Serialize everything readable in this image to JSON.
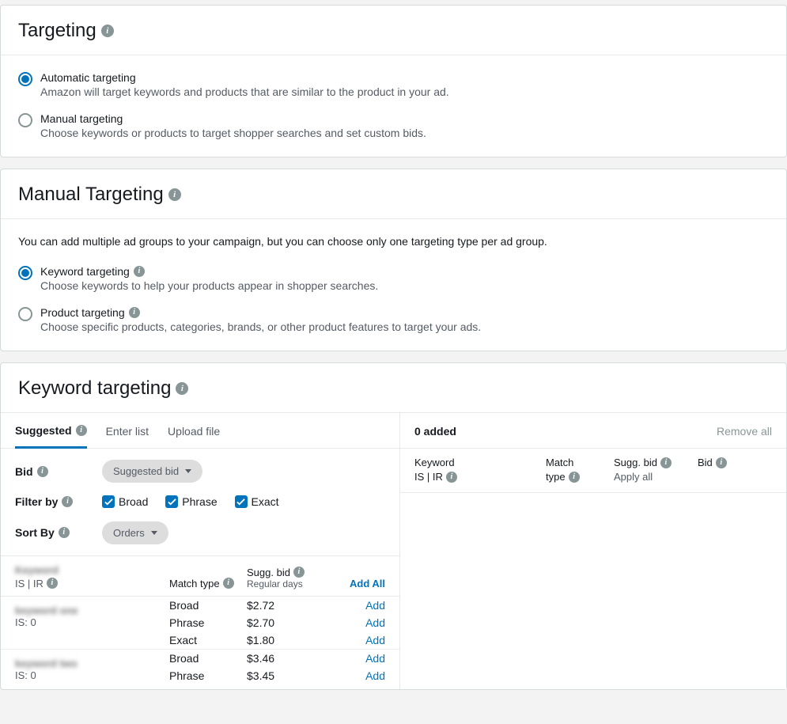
{
  "targeting": {
    "title": "Targeting",
    "options": [
      {
        "label": "Automatic targeting",
        "desc": "Amazon will target keywords and products that are similar to the product in your ad.",
        "selected": true
      },
      {
        "label": "Manual targeting",
        "desc": "Choose keywords or products to target shopper searches and set custom bids.",
        "selected": false
      }
    ]
  },
  "manual": {
    "title": "Manual Targeting",
    "note": "You can add multiple ad groups to your campaign, but you can choose only one targeting type per ad group.",
    "options": [
      {
        "label": "Keyword targeting",
        "desc": "Choose keywords to help your products appear in shopper searches.",
        "selected": true
      },
      {
        "label": "Product targeting",
        "desc": "Choose specific products, categories, brands, or other product features to target your ads.",
        "selected": false
      }
    ]
  },
  "kt": {
    "title": "Keyword targeting",
    "tabs": [
      "Suggested",
      "Enter list",
      "Upload file"
    ],
    "controls": {
      "bid_label": "Bid",
      "bid_value": "Suggested bid",
      "filter_label": "Filter by",
      "filters": [
        "Broad",
        "Phrase",
        "Exact"
      ],
      "sort_label": "Sort By",
      "sort_value": "Orders"
    },
    "header": {
      "match": "Match type",
      "sugg": "Sugg. bid",
      "sugg_sub": "Regular days",
      "add_all": "Add All",
      "isir": "IS | IR"
    },
    "keywords": [
      {
        "name_blur": "keyword one",
        "is": "IS: 0",
        "rows": [
          {
            "match": "Broad",
            "bid": "$2.72",
            "action": "Add"
          },
          {
            "match": "Phrase",
            "bid": "$2.70",
            "action": "Add"
          },
          {
            "match": "Exact",
            "bid": "$1.80",
            "action": "Add"
          }
        ]
      },
      {
        "name_blur": "keyword two",
        "is": "IS: 0",
        "rows": [
          {
            "match": "Broad",
            "bid": "$3.46",
            "action": "Add"
          },
          {
            "match": "Phrase",
            "bid": "$3.45",
            "action": "Add"
          }
        ]
      }
    ],
    "right": {
      "added": "0 added",
      "remove_all": "Remove all",
      "cols": {
        "keyword": "Keyword",
        "isir": "IS | IR",
        "match": "Match type",
        "sugg": "Sugg. bid",
        "apply": "Apply all",
        "bid": "Bid"
      }
    }
  }
}
